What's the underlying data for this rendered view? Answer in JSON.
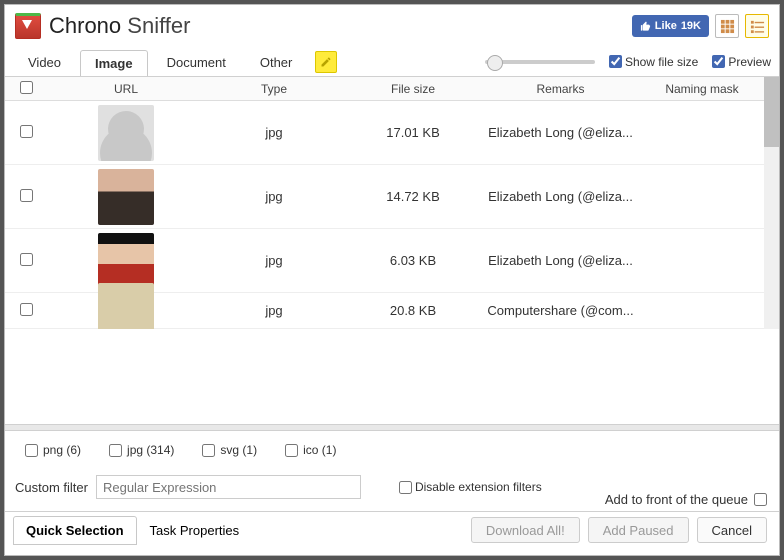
{
  "app": {
    "name": "Chrono",
    "sub": "Sniffer"
  },
  "like": {
    "text": "Like",
    "count": "19K"
  },
  "tabs": [
    "Video",
    "Image",
    "Document",
    "Other"
  ],
  "activeTab": 1,
  "opts": {
    "showFileSize": "Show file size",
    "preview": "Preview"
  },
  "columns": [
    "URL",
    "Type",
    "File size",
    "Remarks",
    "Naming mask"
  ],
  "rows": [
    {
      "thumb": "avatar",
      "type": "jpg",
      "size": "17.01 KB",
      "remarks": "Elizabeth Long (@eliza..."
    },
    {
      "thumb": "p1",
      "type": "jpg",
      "size": "14.72 KB",
      "remarks": "Elizabeth Long (@eliza..."
    },
    {
      "thumb": "p2",
      "type": "jpg",
      "size": "6.03 KB",
      "remarks": "Elizabeth Long (@eliza..."
    },
    {
      "thumb": "p3",
      "type": "jpg",
      "size": "20.8 KB",
      "remarks": "Computershare (@com..."
    }
  ],
  "extFilters": [
    {
      "label": "png (6)"
    },
    {
      "label": "jpg (314)"
    },
    {
      "label": "svg (1)"
    },
    {
      "label": "ico (1)"
    }
  ],
  "customFilter": {
    "label": "Custom filter",
    "placeholder": "Regular Expression",
    "disable": "Disable extension filters"
  },
  "subtabs": [
    "Quick Selection",
    "Task Properties"
  ],
  "queue": "Add to front of the queue",
  "buttons": {
    "dl": "Download All!",
    "paused": "Add Paused",
    "cancel": "Cancel"
  }
}
